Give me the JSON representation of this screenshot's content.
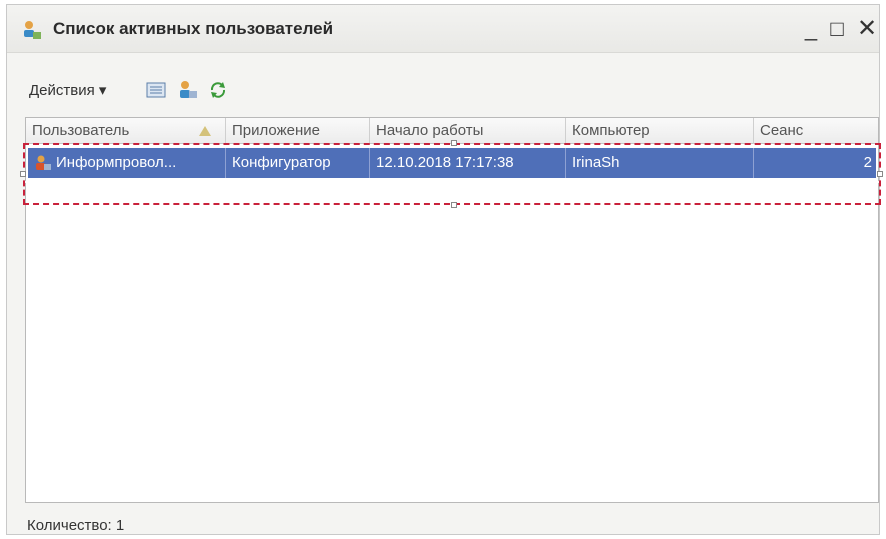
{
  "window": {
    "title": "Список активных пользователей",
    "controls": {
      "minimize": "_",
      "maximize": "□",
      "close": "✕"
    }
  },
  "toolbar": {
    "actions_label": "Действия ▾",
    "icons": [
      "list-icon",
      "user-icon",
      "refresh-icon"
    ]
  },
  "table": {
    "columns": [
      "Пользователь",
      "Приложение",
      "Начало работы",
      "Компьютер",
      "Сеанс"
    ],
    "rows": [
      {
        "user": "Информпровол...",
        "app": "Конфигуратор",
        "start": "12.10.2018 17:17:38",
        "computer": "IrinaSh",
        "session": "2"
      }
    ]
  },
  "footer": {
    "count_label": "Количество:  1"
  },
  "colors": {
    "selection": "#4f6fb8",
    "highlight_frame": "#c9213b"
  }
}
